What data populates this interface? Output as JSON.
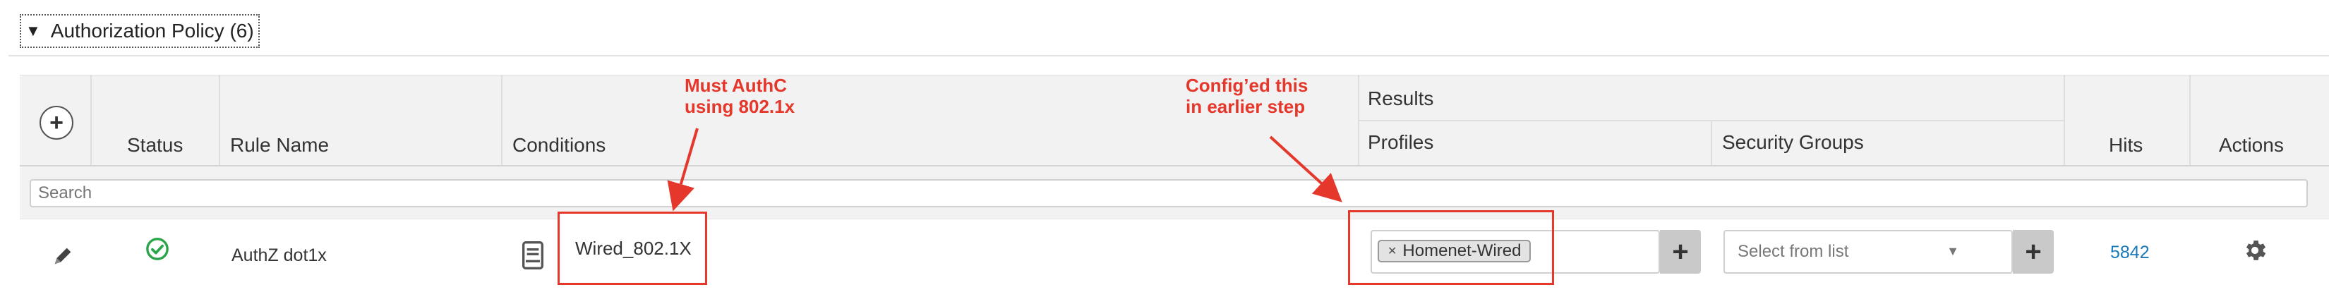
{
  "section": {
    "title": "Authorization Policy (6)"
  },
  "headers": {
    "status": "Status",
    "rule_name": "Rule Name",
    "conditions": "Conditions",
    "results": "Results",
    "profiles": "Profiles",
    "security_groups": "Security Groups",
    "hits": "Hits",
    "actions": "Actions"
  },
  "search": {
    "placeholder": "Search"
  },
  "rows": [
    {
      "rule_name": "AuthZ dot1x",
      "status": "enabled",
      "condition": "Wired_802.1X",
      "profile_tag": "Homenet-Wired",
      "security_group_placeholder": "Select from list",
      "hits": "5842"
    }
  ],
  "annotations": {
    "conditions_note_line1": "Must AuthC",
    "conditions_note_line2": "using  802.1x",
    "profiles_note_line1": "Config’ed this",
    "profiles_note_line2": "in earlier step"
  },
  "colors": {
    "annotation": "#e5372b",
    "status_ok": "#2aa449",
    "hits_link": "#1a7ab8"
  },
  "icons": [
    "chevron-down-icon",
    "add-icon",
    "edit-pencil-icon",
    "status-check-icon",
    "condition-library-icon",
    "remove-x-icon",
    "add-plus-icon",
    "dropdown-caret-icon",
    "gear-icon"
  ]
}
